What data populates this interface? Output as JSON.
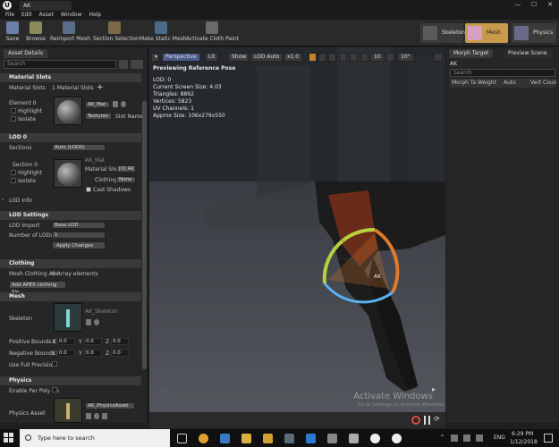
{
  "window": {
    "tab_title": "AK",
    "logo": "U",
    "min": "—",
    "max": "☐",
    "close": "✕"
  },
  "menu": [
    "File",
    "Edit",
    "Asset",
    "Window",
    "Help"
  ],
  "toolbar": {
    "buttons": [
      "Save",
      "Browse",
      "Reimport Mesh",
      "Section Selection",
      "Make Static Mesh",
      "Activate Cloth Paint"
    ],
    "modes": [
      "Skeleton",
      "Mesh",
      "Physics"
    ]
  },
  "left": {
    "tab": "Asset Details",
    "search_placeholder": "Search",
    "material_slots": {
      "header": "Material Slots",
      "label": "Material Slots",
      "count": "1 Material Slots",
      "element": "Element 0",
      "highlight": "Highlight",
      "isolate": "Isolate",
      "material": "AK_Mat",
      "textures": "Textures",
      "slot_name": "Slot Name"
    },
    "lod0": {
      "header": "LOD 0",
      "sections_label": "Sections",
      "sections_value": "Auto (LOD0)",
      "section0": "Section 0",
      "highlight": "Highlight",
      "isolate": "Isolate",
      "material_label": "AK_Mat",
      "material_slot_label": "Material Slot",
      "material_slot_value": "[0] AK",
      "clothing_label": "Clothing",
      "clothing_value": "None",
      "cast_shadows": "Cast Shadows",
      "lod_info": "LOD Info"
    },
    "lod_settings": {
      "header": "LOD Settings",
      "lod_import_label": "LOD Import",
      "lod_import_value": "Base LOD",
      "num_lods_label": "Number of LODs",
      "num_lods_value": "1",
      "apply_label": "Apply Changes"
    },
    "clothing": {
      "header": "Clothing",
      "mesh_clothing_label": "Mesh Clothing Ass",
      "mesh_clothing_value": "0 Array elements",
      "add_button": "Add APEX clothing file..."
    },
    "mesh": {
      "header": "Mesh",
      "skeleton_label": "Skeleton",
      "skeleton_value": "AK_Skeleton",
      "pos_bounds_label": "Positive Bounds E",
      "neg_bounds_label": "Negative Bounds I",
      "x": "X",
      "y": "Y",
      "z": "Z",
      "zero": "0.0",
      "full_precision": "Use Full Precision"
    },
    "physics": {
      "header": "Physics",
      "enable_per_poly": "Enable Per Poly Co",
      "physics_asset_label": "Physics Asset",
      "physics_asset_value": "AK_PhysicsAsset"
    }
  },
  "viewport": {
    "buttons": [
      "Perspective",
      "Lit",
      "Show",
      "LOD Auto",
      "x1.0",
      "10",
      "10°"
    ],
    "preview_label": "Previewing Reference Pose",
    "stats": [
      "LOD: 0",
      "Current Screen Size: 4.03",
      "Triangles: 8892",
      "Vertices: 5823",
      "UV Channels: 1",
      "Approx Size: 106x279x550"
    ],
    "bone_label": "AK",
    "watermark_title": "Activate Windows",
    "watermark_sub": "Go to Settings to activate Windows."
  },
  "right": {
    "tabs": [
      "Morph Target",
      "Preview Scene"
    ],
    "asset": "AK",
    "search_placeholder": "Search",
    "columns": [
      "Morph Ta",
      "Weight",
      "Auto",
      "Vert Coun"
    ]
  },
  "taskbar": {
    "search_placeholder": "Type here to search",
    "lang": "ENG",
    "time": "6:29 PM",
    "date": "1/12/2018"
  }
}
